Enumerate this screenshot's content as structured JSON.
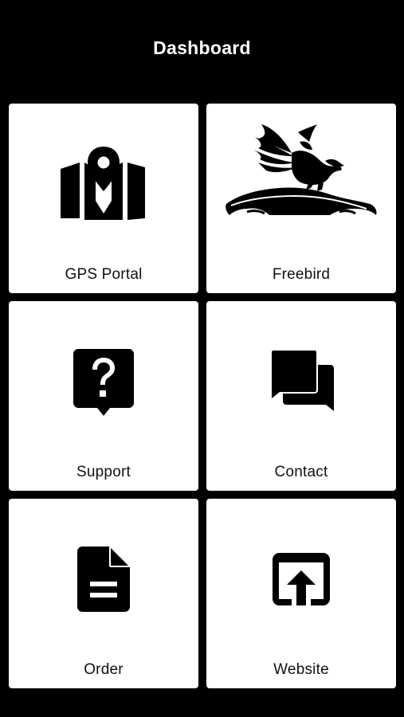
{
  "header": {
    "title": "Dashboard"
  },
  "tiles": [
    {
      "label": "GPS Portal",
      "icon": "map-pin-icon"
    },
    {
      "label": "Freebird",
      "icon": "eagle-car-logo"
    },
    {
      "label": "Support",
      "icon": "question-bubble-icon"
    },
    {
      "label": "Contact",
      "icon": "chat-bubbles-icon"
    },
    {
      "label": "Order",
      "icon": "document-icon"
    },
    {
      "label": "Website",
      "icon": "open-in-browser-icon"
    }
  ],
  "colors": {
    "background": "#000000",
    "tile": "#ffffff",
    "icon": "#000000",
    "text": "#111111"
  }
}
